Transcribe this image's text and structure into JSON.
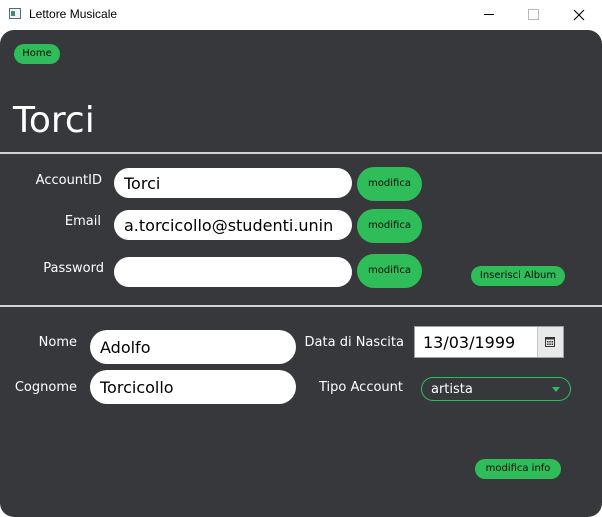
{
  "window": {
    "title": "Lettore Musicale"
  },
  "nav": {
    "home_label": "Home"
  },
  "header": {
    "title": "Torci"
  },
  "account": {
    "account_id_label": "AccountID",
    "account_id_value": "Torci",
    "email_label": "Email",
    "email_value": "a.torcicollo@studenti.unin",
    "password_label": "Password",
    "password_value": "",
    "modify_label": "modifica",
    "insert_album_label": "Inserisci Album"
  },
  "info": {
    "name_label": "Nome",
    "name_value": "Adolfo",
    "surname_label": "Cognome",
    "surname_value": "Torcicollo",
    "birthdate_label": "Data di Nascita",
    "birthdate_value": "13/03/1999",
    "account_type_label": "Tipo Account",
    "account_type_value": "artista",
    "modify_info_label": "modifica info"
  },
  "colors": {
    "panel_bg": "#36383c",
    "accent_green": "#2ebd59",
    "separator": "#cfd2d6"
  }
}
